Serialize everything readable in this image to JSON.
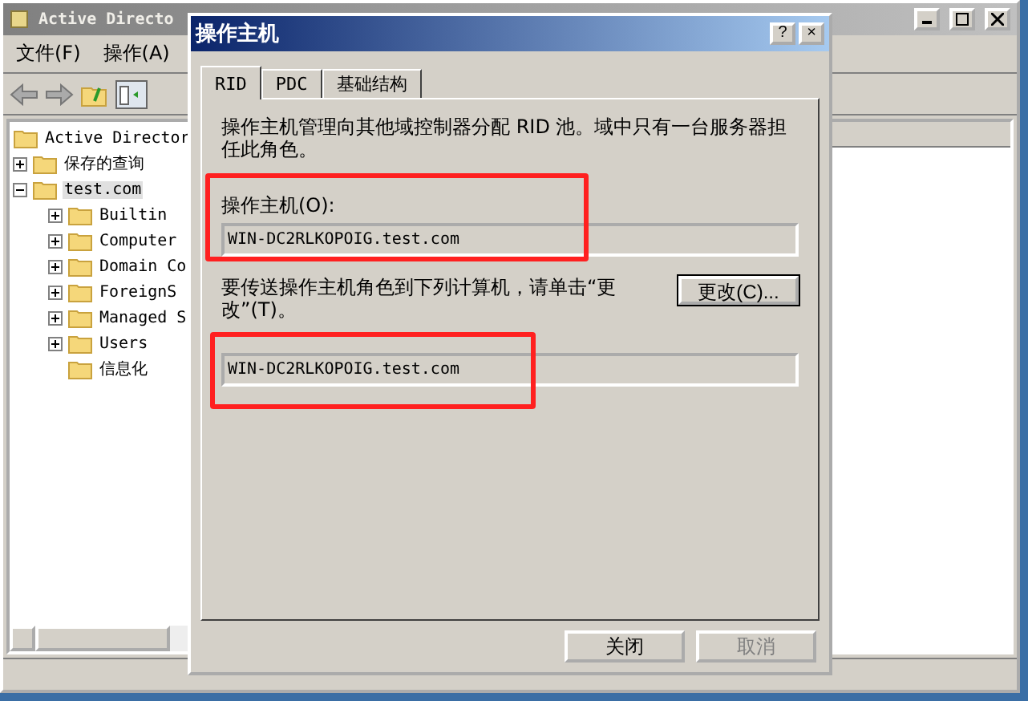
{
  "main_window": {
    "title": "Active Directo",
    "menu": [
      "文件(F)",
      "操作(A)"
    ],
    "tree": [
      {
        "kind": "leaf",
        "label": "Active Director"
      },
      {
        "kind": "node",
        "label": "保存的查询",
        "expanded": false
      },
      {
        "kind": "node",
        "label": "test.com",
        "expanded": true,
        "selected": true,
        "children": [
          {
            "kind": "node",
            "label": "Builtin",
            "expanded": false
          },
          {
            "kind": "node",
            "label": "Computer",
            "expanded": false
          },
          {
            "kind": "node",
            "label": "Domain Co",
            "expanded": false
          },
          {
            "kind": "node",
            "label": "ForeignS",
            "expanded": false
          },
          {
            "kind": "node",
            "label": "Managed S",
            "expanded": false
          },
          {
            "kind": "node",
            "label": "Users",
            "expanded": false
          },
          {
            "kind": "leaf",
            "label": "信息化"
          }
        ]
      }
    ]
  },
  "dialog": {
    "title": "操作主机",
    "help": "?",
    "close": "×",
    "tabs": [
      {
        "label": "RID",
        "selected": true
      },
      {
        "label": "PDC",
        "selected": false
      },
      {
        "label": "基础结构",
        "selected": false
      }
    ],
    "description": "操作主机管理向其他域控制器分配 RID 池。域中只有一台服务器担任此角色。",
    "master_label": "操作主机(O):",
    "master_value": "WIN-DC2RLKOPOIG.test.com",
    "master_highlighted": true,
    "transfer_text": "要传送操作主机角色到下列计算机，请单击“更改”(T)。",
    "change_button": "更改(C)...",
    "target_value": "WIN-DC2RLKOPOIG.test.com",
    "target_highlighted": true,
    "buttons": [
      {
        "label": "关闭",
        "disabled": false
      },
      {
        "label": "取消",
        "disabled": true
      }
    ]
  }
}
